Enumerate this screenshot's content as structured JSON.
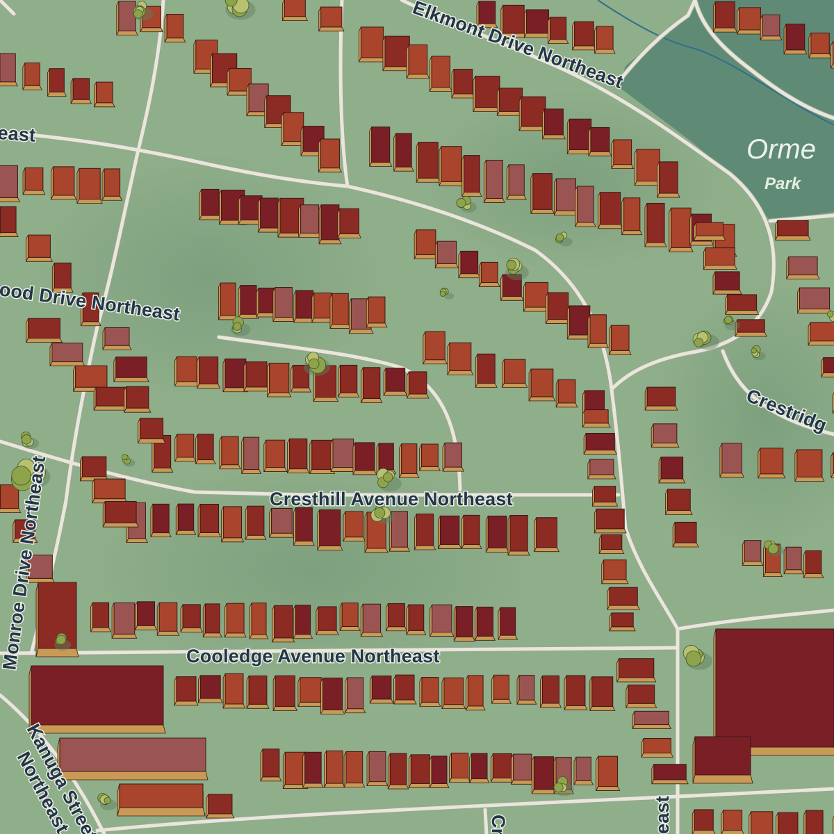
{
  "map": {
    "colors": {
      "ground": "#8fae8a",
      "ground_dark": "#7a9c7c",
      "park": "#5f8b76",
      "road": "#e9e6da",
      "roof_red": "#8c2a24",
      "roof_orange": "#a8452c",
      "roof_maroon": "#7a1f26",
      "roof_pink": "#9a5552",
      "wall": "#c99a55",
      "tree": "#8fa34a",
      "label": "#253548",
      "water": "#2f6f88"
    },
    "streets": [
      {
        "id": "elkmont",
        "label": "Elkmont Drive Northeast"
      },
      {
        "id": "east-top",
        "label": "east"
      },
      {
        "id": "wood",
        "label": "ood Drive Northeast"
      },
      {
        "id": "cresthill",
        "label": "Cresthill Avenue Northeast"
      },
      {
        "id": "cooledge",
        "label": "Cooledge Avenue Northeast"
      },
      {
        "id": "monroe",
        "label": "Monroe Drive Northeast"
      },
      {
        "id": "kanuga1",
        "label": "Kanuga Street"
      },
      {
        "id": "kanuga2",
        "label": "Northeast"
      },
      {
        "id": "crestridge",
        "label": "Crestridg"
      },
      {
        "id": "east-bottom",
        "label": "east"
      },
      {
        "id": "c-bottom",
        "label": "Cr"
      }
    ],
    "park": {
      "name": "Orme",
      "subtitle": "Park"
    },
    "icons": [
      "tree-icon",
      "building-icon"
    ]
  }
}
